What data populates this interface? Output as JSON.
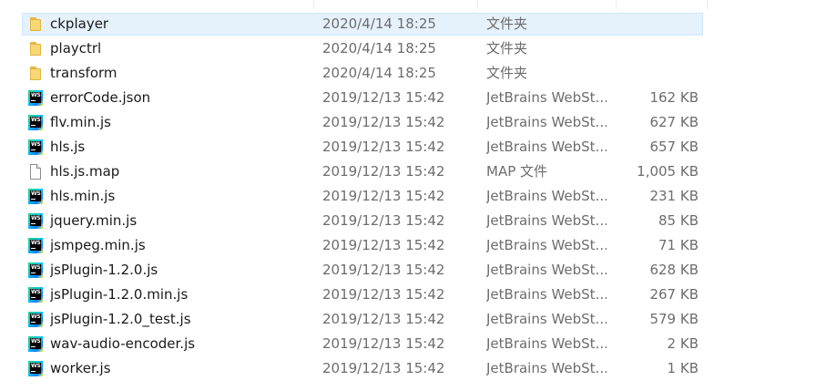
{
  "files": [
    {
      "name": "ckplayer",
      "date": "2020/4/14 18:25",
      "type": "文件夹",
      "size": "",
      "icon": "folder-icon",
      "selected": true
    },
    {
      "name": "playctrl",
      "date": "2020/4/14 18:25",
      "type": "文件夹",
      "size": "",
      "icon": "folder-icon"
    },
    {
      "name": "transform",
      "date": "2020/4/14 18:25",
      "type": "文件夹",
      "size": "",
      "icon": "folder-icon"
    },
    {
      "name": "errorCode.json",
      "date": "2019/12/13 15:42",
      "type": "JetBrains WebSt...",
      "size": "162 KB",
      "icon": "webstorm-icon"
    },
    {
      "name": "flv.min.js",
      "date": "2019/12/13 15:42",
      "type": "JetBrains WebSt...",
      "size": "627 KB",
      "icon": "webstorm-icon"
    },
    {
      "name": "hls.js",
      "date": "2019/12/13 15:42",
      "type": "JetBrains WebSt...",
      "size": "657 KB",
      "icon": "webstorm-icon"
    },
    {
      "name": "hls.js.map",
      "date": "2019/12/13 15:42",
      "type": "MAP 文件",
      "size": "1,005 KB",
      "icon": "file-icon"
    },
    {
      "name": "hls.min.js",
      "date": "2019/12/13 15:42",
      "type": "JetBrains WebSt...",
      "size": "231 KB",
      "icon": "webstorm-icon"
    },
    {
      "name": "jquery.min.js",
      "date": "2019/12/13 15:42",
      "type": "JetBrains WebSt...",
      "size": "85 KB",
      "icon": "webstorm-icon"
    },
    {
      "name": "jsmpeg.min.js",
      "date": "2019/12/13 15:42",
      "type": "JetBrains WebSt...",
      "size": "71 KB",
      "icon": "webstorm-icon"
    },
    {
      "name": "jsPlugin-1.2.0.js",
      "date": "2019/12/13 15:42",
      "type": "JetBrains WebSt...",
      "size": "628 KB",
      "icon": "webstorm-icon"
    },
    {
      "name": "jsPlugin-1.2.0.min.js",
      "date": "2019/12/13 15:42",
      "type": "JetBrains WebSt...",
      "size": "267 KB",
      "icon": "webstorm-icon"
    },
    {
      "name": "jsPlugin-1.2.0_test.js",
      "date": "2019/12/13 15:42",
      "type": "JetBrains WebSt...",
      "size": "579 KB",
      "icon": "webstorm-icon"
    },
    {
      "name": "wav-audio-encoder.js",
      "date": "2019/12/13 15:42",
      "type": "JetBrains WebSt...",
      "size": "2 KB",
      "icon": "webstorm-icon"
    },
    {
      "name": "worker.js",
      "date": "2019/12/13 15:42",
      "type": "JetBrains WebSt...",
      "size": "1 KB",
      "icon": "webstorm-icon"
    }
  ],
  "colors": {
    "selection": "#e5f1fb",
    "folder": "#f8d775",
    "secondary_text": "#6d6d6d"
  }
}
